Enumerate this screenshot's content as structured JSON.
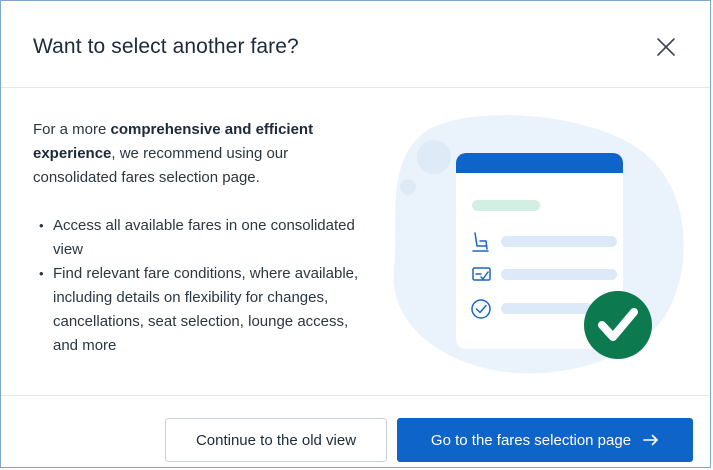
{
  "dialog": {
    "title": "Want to select another fare?",
    "close_icon": "close-icon"
  },
  "content": {
    "intro_prefix": "For a more ",
    "intro_bold": "comprehensive and efficient experience",
    "intro_suffix": ", we recommend using our consolidated fares selection page.",
    "bullets": [
      "Access all available fares in one consolidated view",
      "Find relevant fare conditions, where available, including details on flexibility for changes, cancellations, seat selection, lounge access, and more"
    ]
  },
  "illustration": {
    "icons": [
      "seat-icon",
      "ticket-icon",
      "check-circle-icon",
      "check-badge-icon"
    ],
    "colors": {
      "blob": "#eaf2fb",
      "card_header": "#0f64c9",
      "pill_green": "#d3eee3",
      "pill_blue": "#dbe9f8",
      "badge": "#0c7a4e"
    }
  },
  "footer": {
    "secondary_label": "Continue to the old view",
    "primary_label": "Go to the fares selection page",
    "primary_icon": "arrow-right-icon"
  },
  "colors": {
    "accent": "#0f64c9",
    "title_text": "#1c2a3a"
  }
}
